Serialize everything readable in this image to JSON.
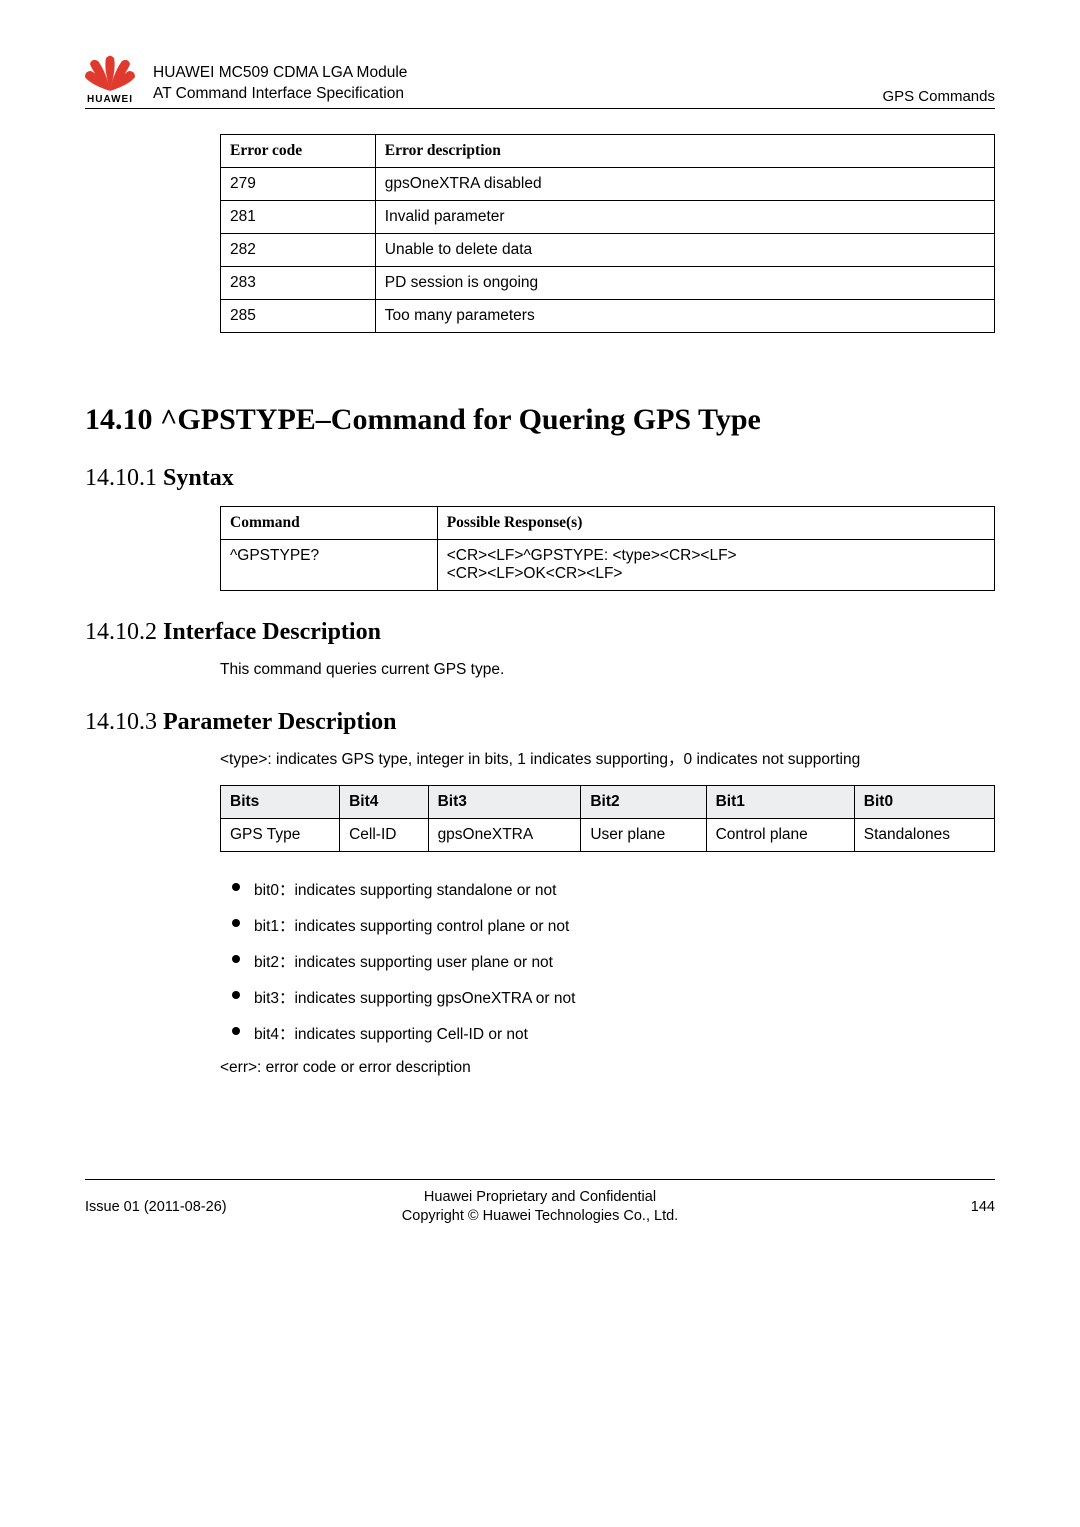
{
  "header": {
    "title_line1": "HUAWEI MC509 CDMA LGA Module",
    "title_line2": "AT Command Interface Specification",
    "right": "GPS Commands",
    "logo_text": "HUAWEI"
  },
  "error_table": {
    "headers": {
      "code": "Error code",
      "desc": "Error description"
    },
    "rows": [
      {
        "code": "279",
        "desc": "gpsOneXTRA disabled"
      },
      {
        "code": "281",
        "desc": "Invalid parameter"
      },
      {
        "code": "282",
        "desc": "Unable to delete data"
      },
      {
        "code": "283",
        "desc": "PD session is ongoing"
      },
      {
        "code": "285",
        "desc": "Too many parameters"
      }
    ]
  },
  "section": {
    "title": "14.10 ^GPSTYPE–Command for Quering GPS Type",
    "syntax": {
      "num": "14.10.1 ",
      "label": "Syntax",
      "headers": {
        "cmd": "Command",
        "resp": "Possible Response(s)"
      },
      "row": {
        "cmd": "^GPSTYPE?",
        "resp_l1": "<CR><LF>^GPSTYPE: <type><CR><LF>",
        "resp_l2": "<CR><LF>OK<CR><LF>"
      }
    },
    "interface": {
      "num": "14.10.2 ",
      "label": "Interface Description",
      "text": "This command queries current GPS type."
    },
    "param": {
      "num": "14.10.3 ",
      "label": "Parameter Description",
      "intro": "<type>: indicates GPS type, integer in bits, 1 indicates supporting，0 indicates not supporting",
      "bits_table": {
        "headers": [
          "Bits",
          "Bit4",
          "Bit3",
          "Bit2",
          "Bit1",
          "Bit0"
        ],
        "row": [
          "GPS Type",
          "Cell-ID",
          "gpsOneXTRA",
          "User plane",
          "Control plane",
          "Standalones"
        ]
      },
      "bit_items": [
        "bit0：indicates supporting standalone or not",
        "bit1：indicates supporting control plane or not",
        "bit2：indicates supporting user plane or not",
        "bit3：indicates supporting gpsOneXTRA or not",
        "bit4：indicates supporting Cell-ID or not"
      ],
      "err_note": "<err>: error code or error description"
    }
  },
  "footer": {
    "left": "Issue 01 (2011-08-26)",
    "center_l1": "Huawei Proprietary and Confidential",
    "center_l2": "Copyright © Huawei Technologies Co., Ltd.",
    "right": "144"
  }
}
